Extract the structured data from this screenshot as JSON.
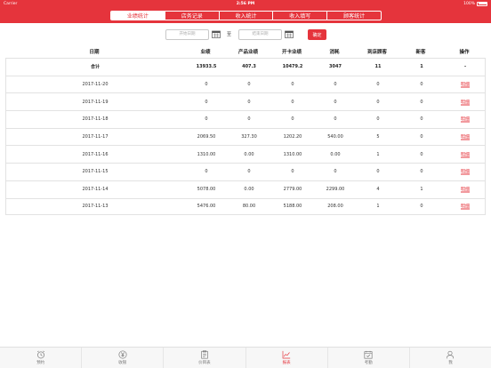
{
  "status": {
    "carrier": "Carrier",
    "time": "2:56 PM",
    "battery": "100%"
  },
  "colors": {
    "accent": "#e5343c"
  },
  "tabs": [
    {
      "label": "业绩统计",
      "active": true
    },
    {
      "label": "店务记录",
      "active": false
    },
    {
      "label": "收入统计",
      "active": false
    },
    {
      "label": "收入填写",
      "active": false
    },
    {
      "label": "顾客统计",
      "active": false
    }
  ],
  "filter": {
    "start_placeholder": "开始日期",
    "end_placeholder": "结束日期",
    "to_label": "至",
    "confirm_label": "确定"
  },
  "columns": [
    "日期",
    "业绩",
    "产品业绩",
    "开卡业绩",
    "消耗",
    "到店顾客",
    "新客",
    "操作"
  ],
  "total_row": [
    "合计",
    "13933.5",
    "407.3",
    "10479.2",
    "3047",
    "11",
    "1",
    "-"
  ],
  "rows": [
    [
      "2017-11-20",
      "0",
      "0",
      "0",
      "0",
      "0",
      "0",
      "明细"
    ],
    [
      "2017-11-19",
      "0",
      "0",
      "0",
      "0",
      "0",
      "0",
      "明细"
    ],
    [
      "2017-11-18",
      "0",
      "0",
      "0",
      "0",
      "0",
      "0",
      "明细"
    ],
    [
      "2017-11-17",
      "2069.50",
      "327.30",
      "1202.20",
      "540.00",
      "5",
      "0",
      "明细"
    ],
    [
      "2017-11-16",
      "1310.00",
      "0.00",
      "1310.00",
      "0.00",
      "1",
      "0",
      "明细"
    ],
    [
      "2017-11-15",
      "0",
      "0",
      "0",
      "0",
      "0",
      "0",
      "明细"
    ],
    [
      "2017-11-14",
      "5078.00",
      "0.00",
      "2779.00",
      "2299.00",
      "4",
      "1",
      "明细"
    ],
    [
      "2017-11-13",
      "5476.00",
      "80.00",
      "5188.00",
      "208.00",
      "1",
      "0",
      "明细"
    ]
  ],
  "bottom_nav": [
    {
      "label": "预约",
      "icon": "alarm-clock-icon",
      "active": false
    },
    {
      "label": "收银",
      "icon": "yen-icon",
      "active": false
    },
    {
      "label": "价目表",
      "icon": "price-list-icon",
      "active": false
    },
    {
      "label": "报表",
      "icon": "report-chart-icon",
      "active": true
    },
    {
      "label": "考勤",
      "icon": "attendance-calendar-icon",
      "active": false
    },
    {
      "label": "我",
      "icon": "user-icon",
      "active": false
    }
  ]
}
